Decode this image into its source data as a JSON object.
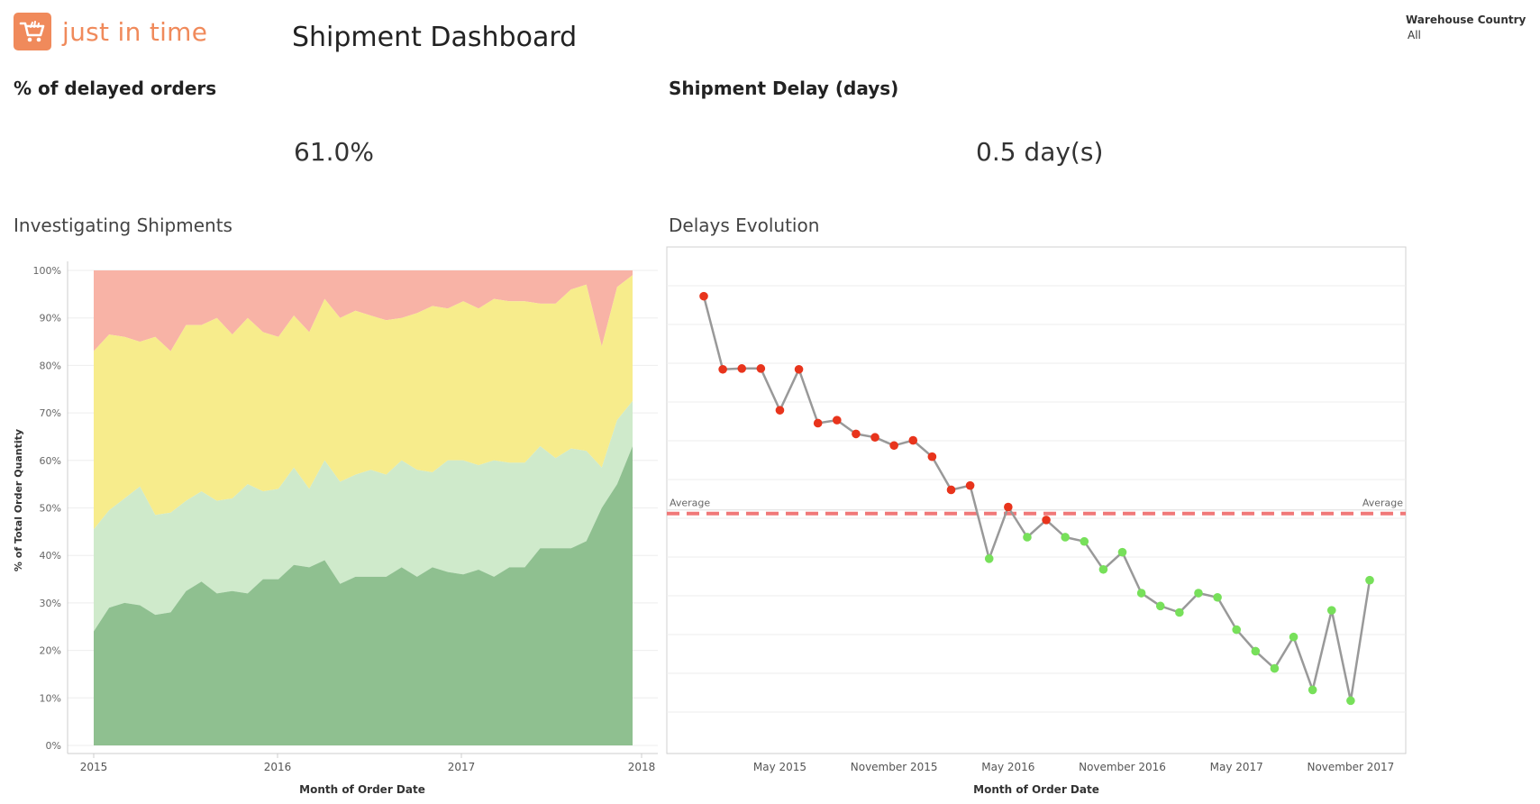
{
  "header": {
    "logo_text": "just in time",
    "dashboard_title": "Shipment Dashboard",
    "filter": {
      "label": "Warehouse Country",
      "value": "All"
    }
  },
  "kpis": {
    "delayed_title": "% of delayed orders",
    "delayed_value": "61.0%",
    "delay_title": "Shipment Delay (days)",
    "delay_value": "0.5 day(s)"
  },
  "colors": {
    "accent": "#f08a5b",
    "band_red": "#f8b3a6",
    "band_yellow": "#f7ec8c",
    "band_lightgreen": "#cfeacb",
    "band_darkgreen": "#8fc090",
    "line": "#999999",
    "point_red": "#e8341c",
    "point_green": "#77e05a",
    "average_line": "#f07878"
  },
  "chart_data": [
    {
      "type": "area",
      "title": "Investigating Shipments",
      "xlabel": "Month of Order Date",
      "ylabel": "% of Total Order Quantity",
      "ylim": [
        0,
        100
      ],
      "yticks": [
        "0%",
        "10%",
        "20%",
        "30%",
        "40%",
        "50%",
        "60%",
        "70%",
        "80%",
        "90%",
        "100%"
      ],
      "xticks": [
        "2015",
        "2016",
        "2017",
        "2018"
      ],
      "x": [
        "2015-01",
        "2015-02",
        "2015-03",
        "2015-04",
        "2015-05",
        "2015-06",
        "2015-07",
        "2015-08",
        "2015-09",
        "2015-10",
        "2015-11",
        "2015-12",
        "2016-01",
        "2016-02",
        "2016-03",
        "2016-04",
        "2016-05",
        "2016-06",
        "2016-07",
        "2016-08",
        "2016-09",
        "2016-10",
        "2016-11",
        "2016-12",
        "2017-01",
        "2017-02",
        "2017-03",
        "2017-04",
        "2017-05",
        "2017-06",
        "2017-07",
        "2017-08",
        "2017-09",
        "2017-10",
        "2017-11",
        "2017-12"
      ],
      "stacked_boundaries": {
        "dark_green_top": [
          24,
          29,
          30,
          29.5,
          27.5,
          28,
          32.5,
          34.5,
          32,
          32.5,
          32,
          35,
          35,
          38,
          37.5,
          39,
          34,
          35.5,
          35.5,
          35.5,
          37.5,
          35.5,
          37.5,
          36.5,
          36,
          37,
          35.5,
          37.5,
          37.5,
          41.5,
          41.5,
          41.5,
          43,
          50,
          55,
          63
        ],
        "light_green_top": [
          45.5,
          49.5,
          52,
          54.5,
          48.5,
          49,
          51.5,
          53.5,
          51.5,
          52,
          55,
          53.5,
          54,
          58.5,
          54,
          60,
          55.5,
          57,
          58,
          57,
          60,
          58,
          57.5,
          60,
          60,
          59,
          60,
          59.5,
          59.5,
          63,
          60.5,
          62.5,
          62,
          58.5,
          68.5,
          72.5
        ],
        "yellow_top": [
          83,
          86.5,
          86,
          85,
          86,
          83,
          88.5,
          88.5,
          90,
          86.5,
          90,
          87,
          86,
          90.5,
          87,
          94,
          90,
          91.5,
          90.5,
          89.5,
          90,
          91,
          92.5,
          92,
          93.5,
          92,
          94,
          93.5,
          93.5,
          93,
          93,
          96,
          97,
          84,
          96.5,
          99
        ],
        "red_top": [
          100,
          100,
          100,
          100,
          100,
          100,
          100,
          100,
          100,
          100,
          100,
          100,
          100,
          100,
          100,
          100,
          100,
          100,
          100,
          100,
          100,
          100,
          100,
          100,
          100,
          100,
          100,
          100,
          100,
          100,
          100,
          100,
          100,
          100,
          100,
          100
        ]
      }
    },
    {
      "type": "line",
      "title": "Delays Evolution",
      "xlabel": "Month of Order Date",
      "xticks": [
        "May 2015",
        "November 2015",
        "May 2016",
        "November 2016",
        "May 2017",
        "November 2017"
      ],
      "reference_line_label": "Average",
      "x": [
        "2015-01",
        "2015-02",
        "2015-03",
        "2015-04",
        "2015-05",
        "2015-06",
        "2015-07",
        "2015-08",
        "2015-09",
        "2015-10",
        "2015-11",
        "2015-12",
        "2016-01",
        "2016-02",
        "2016-03",
        "2016-04",
        "2016-05",
        "2016-06",
        "2016-07",
        "2016-08",
        "2016-09",
        "2016-10",
        "2016-11",
        "2016-12",
        "2017-01",
        "2017-02",
        "2017-03",
        "2017-04",
        "2017-05",
        "2017-06",
        "2017-07",
        "2017-08",
        "2017-09",
        "2017-10",
        "2017-11",
        "2017-12"
      ],
      "values": [
        1.0,
        0.83,
        0.832,
        0.832,
        0.735,
        0.83,
        0.705,
        0.712,
        0.68,
        0.672,
        0.653,
        0.665,
        0.627,
        0.55,
        0.56,
        0.39,
        0.51,
        0.44,
        0.48,
        0.44,
        0.43,
        0.365,
        0.405,
        0.31,
        0.28,
        0.265,
        0.31,
        0.3,
        0.225,
        0.175,
        0.135,
        0.208,
        0.085,
        0.27,
        0.06,
        0.34
      ],
      "point_status": [
        "above",
        "above",
        "above",
        "above",
        "above",
        "above",
        "above",
        "above",
        "above",
        "above",
        "above",
        "above",
        "above",
        "above",
        "above",
        "below",
        "above",
        "below",
        "above",
        "below",
        "below",
        "below",
        "below",
        "below",
        "below",
        "below",
        "below",
        "below",
        "below",
        "below",
        "below",
        "below",
        "below",
        "below",
        "below",
        "below"
      ],
      "average": 0.495,
      "ylim": [
        0,
        1.06
      ]
    }
  ]
}
